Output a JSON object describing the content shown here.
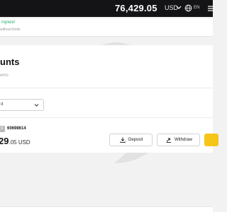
{
  "topbar": {
    "balance": "76,429.05",
    "currency": "USD",
    "language": "EN",
    "icons": [
      "chevron-down-icon",
      "globe-icon",
      "menu-icon"
    ]
  },
  "notice": {
    "line1": "mplete!",
    "line2": "without limits"
  },
  "accounts_panel": {
    "title": "unts",
    "subtitle": "emo",
    "filter_value": "ıt"
  },
  "account": {
    "badge": "S",
    "id": "60698614",
    "balance_main": "29",
    "balance_decimals": ".05 USD",
    "deposit_label": "Deposit",
    "withdraw_label": "Withdraw"
  },
  "colors": {
    "topbar_bg": "#141416",
    "success_text": "#2bb673",
    "trade_button": "#f5c518"
  }
}
